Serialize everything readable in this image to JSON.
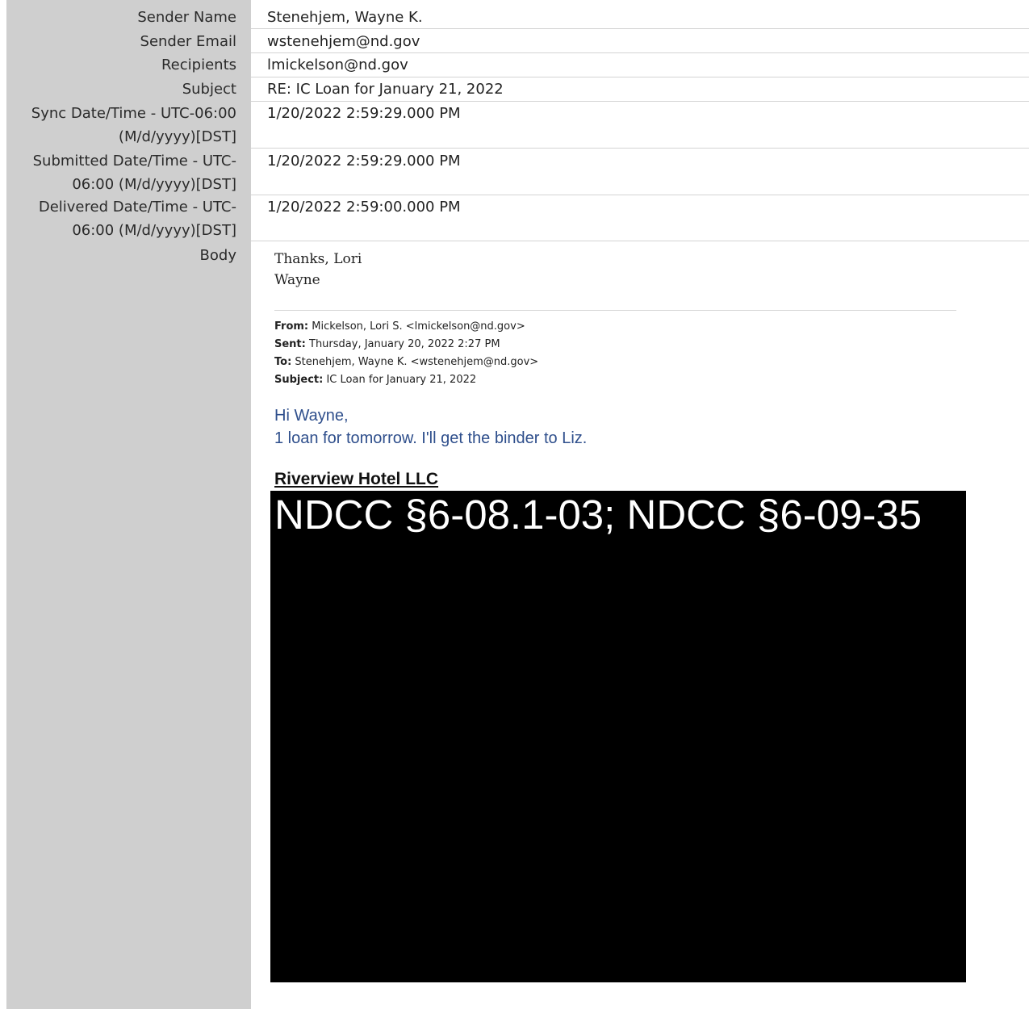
{
  "fields": [
    {
      "label": "Sender Name",
      "value": "Stenehjem, Wayne K."
    },
    {
      "label": "Sender Email",
      "value": "wstenehjem@nd.gov"
    },
    {
      "label": "Recipients",
      "value": "lmickelson@nd.gov"
    },
    {
      "label": "Subject",
      "value": "RE: IC Loan for January 21, 2022"
    },
    {
      "label_line1": "Sync Date/Time - UTC-06:00",
      "label_line2": "(M/d/yyyy)[DST]",
      "value": "1/20/2022 2:59:29.000 PM"
    },
    {
      "label_line1": "Submitted Date/Time - UTC-",
      "label_line2": "06:00 (M/d/yyyy)[DST]",
      "value": "1/20/2022 2:59:29.000 PM"
    },
    {
      "label_line1": "Delivered Date/Time - UTC-",
      "label_line2": "06:00 (M/d/yyyy)[DST]",
      "value": "1/20/2022 2:59:00.000 PM"
    }
  ],
  "body_label": "Body",
  "body": {
    "signoff_line1": "Thanks, Lori",
    "signoff_line2": "Wayne",
    "forward": {
      "from_label": "From:",
      "from_value": "Mickelson, Lori S. <lmickelson@nd.gov>",
      "sent_label": "Sent:",
      "sent_value": "Thursday, January 20, 2022 2:27 PM",
      "to_label": "To:",
      "to_value": "Stenehjem, Wayne K. <wstenehjem@nd.gov>",
      "subject_label": "Subject:",
      "subject_value": "IC Loan for January 21, 2022"
    },
    "greeting": "Hi Wayne,",
    "message": "1 loan for tomorrow.  I'll get the binder to Liz.",
    "company": "Riverview Hotel LLC",
    "redaction_text": "NDCC §6-08.1-03; NDCC §6-09-35"
  }
}
